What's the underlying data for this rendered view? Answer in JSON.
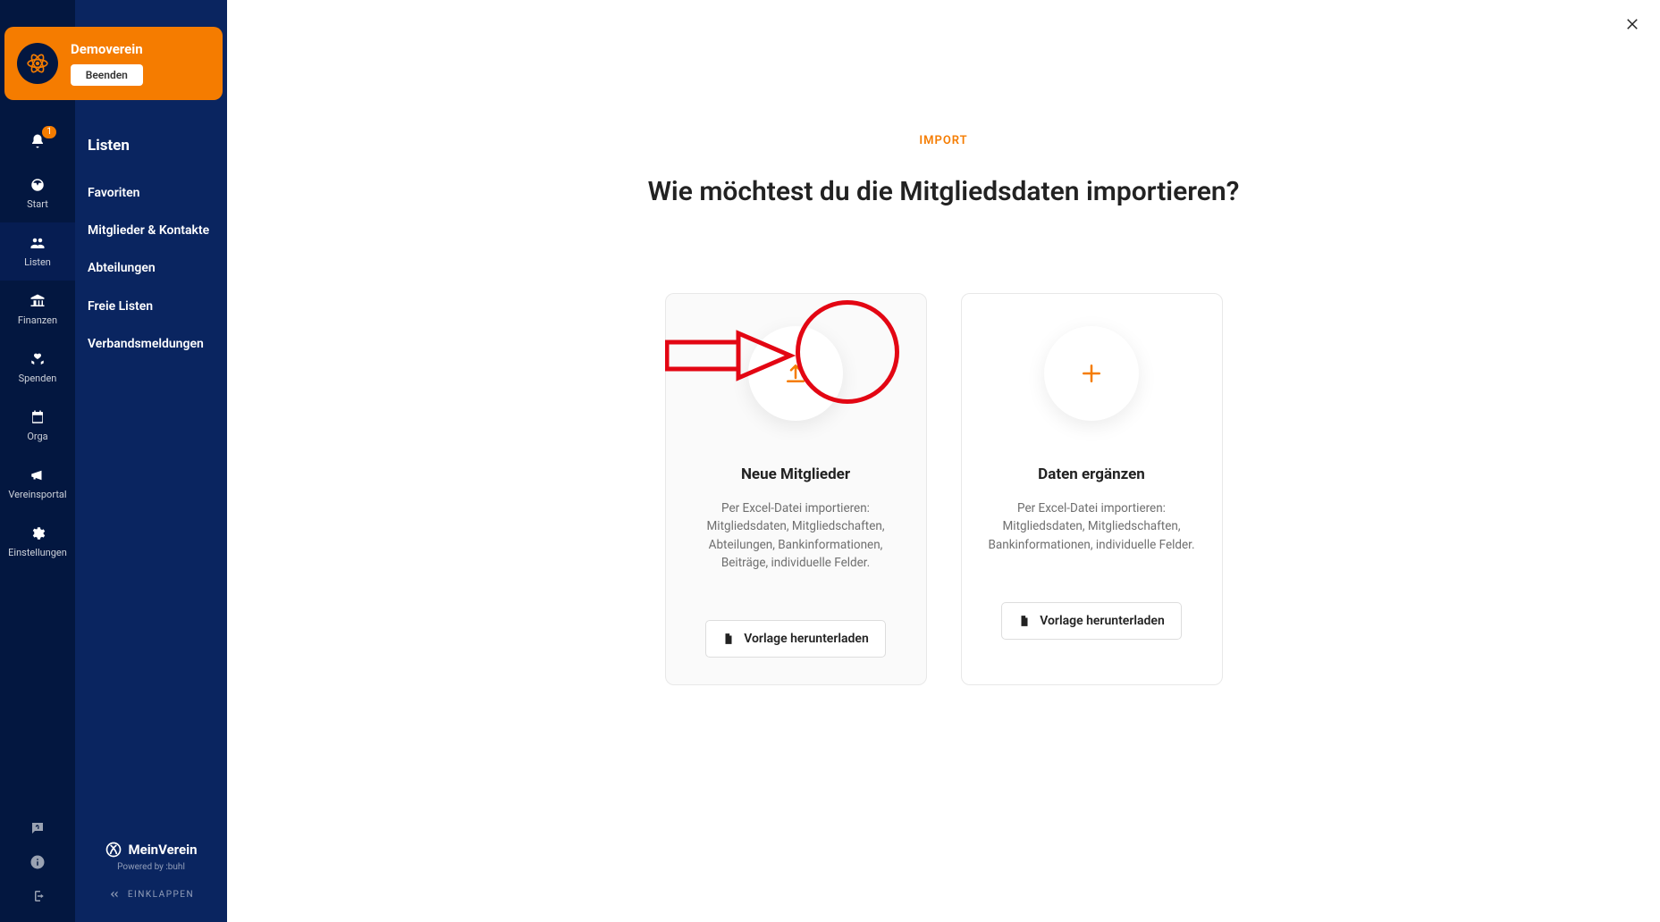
{
  "demo": {
    "name": "Demoverein",
    "exit": "Beenden"
  },
  "rail": {
    "notifications_badge": "1",
    "items": [
      {
        "label": "Start"
      },
      {
        "label": "Listen"
      },
      {
        "label": "Finanzen"
      },
      {
        "label": "Spenden"
      },
      {
        "label": "Orga"
      },
      {
        "label": "Vereinsportal"
      },
      {
        "label": "Einstellungen"
      }
    ]
  },
  "subnav": {
    "title": "Listen",
    "items": [
      "Favoriten",
      "Mitglieder & Kontakte",
      "Abteilungen",
      "Freie Listen",
      "Verbandsmeldungen"
    ],
    "brand": "MeinVerein",
    "powered": "Powered by :buhl",
    "collapse": "EINKLAPPEN"
  },
  "main": {
    "eyebrow": "IMPORT",
    "headline": "Wie möchtest du die Mitgliedsdaten importieren?",
    "cards": [
      {
        "title": "Neue Mitglieder",
        "desc": "Per Excel-Datei importieren: Mitgliedsdaten, Mitgliedschaften, Abteilungen, Bankinformationen, Beiträge, individuelle Felder.",
        "download": "Vorlage herunterladen"
      },
      {
        "title": "Daten ergänzen",
        "desc": "Per Excel-Datei importieren: Mitgliedsdaten, Mitgliedschaften, Bankinformationen, individuelle Felder.",
        "download": "Vorlage herunterladen"
      }
    ]
  }
}
